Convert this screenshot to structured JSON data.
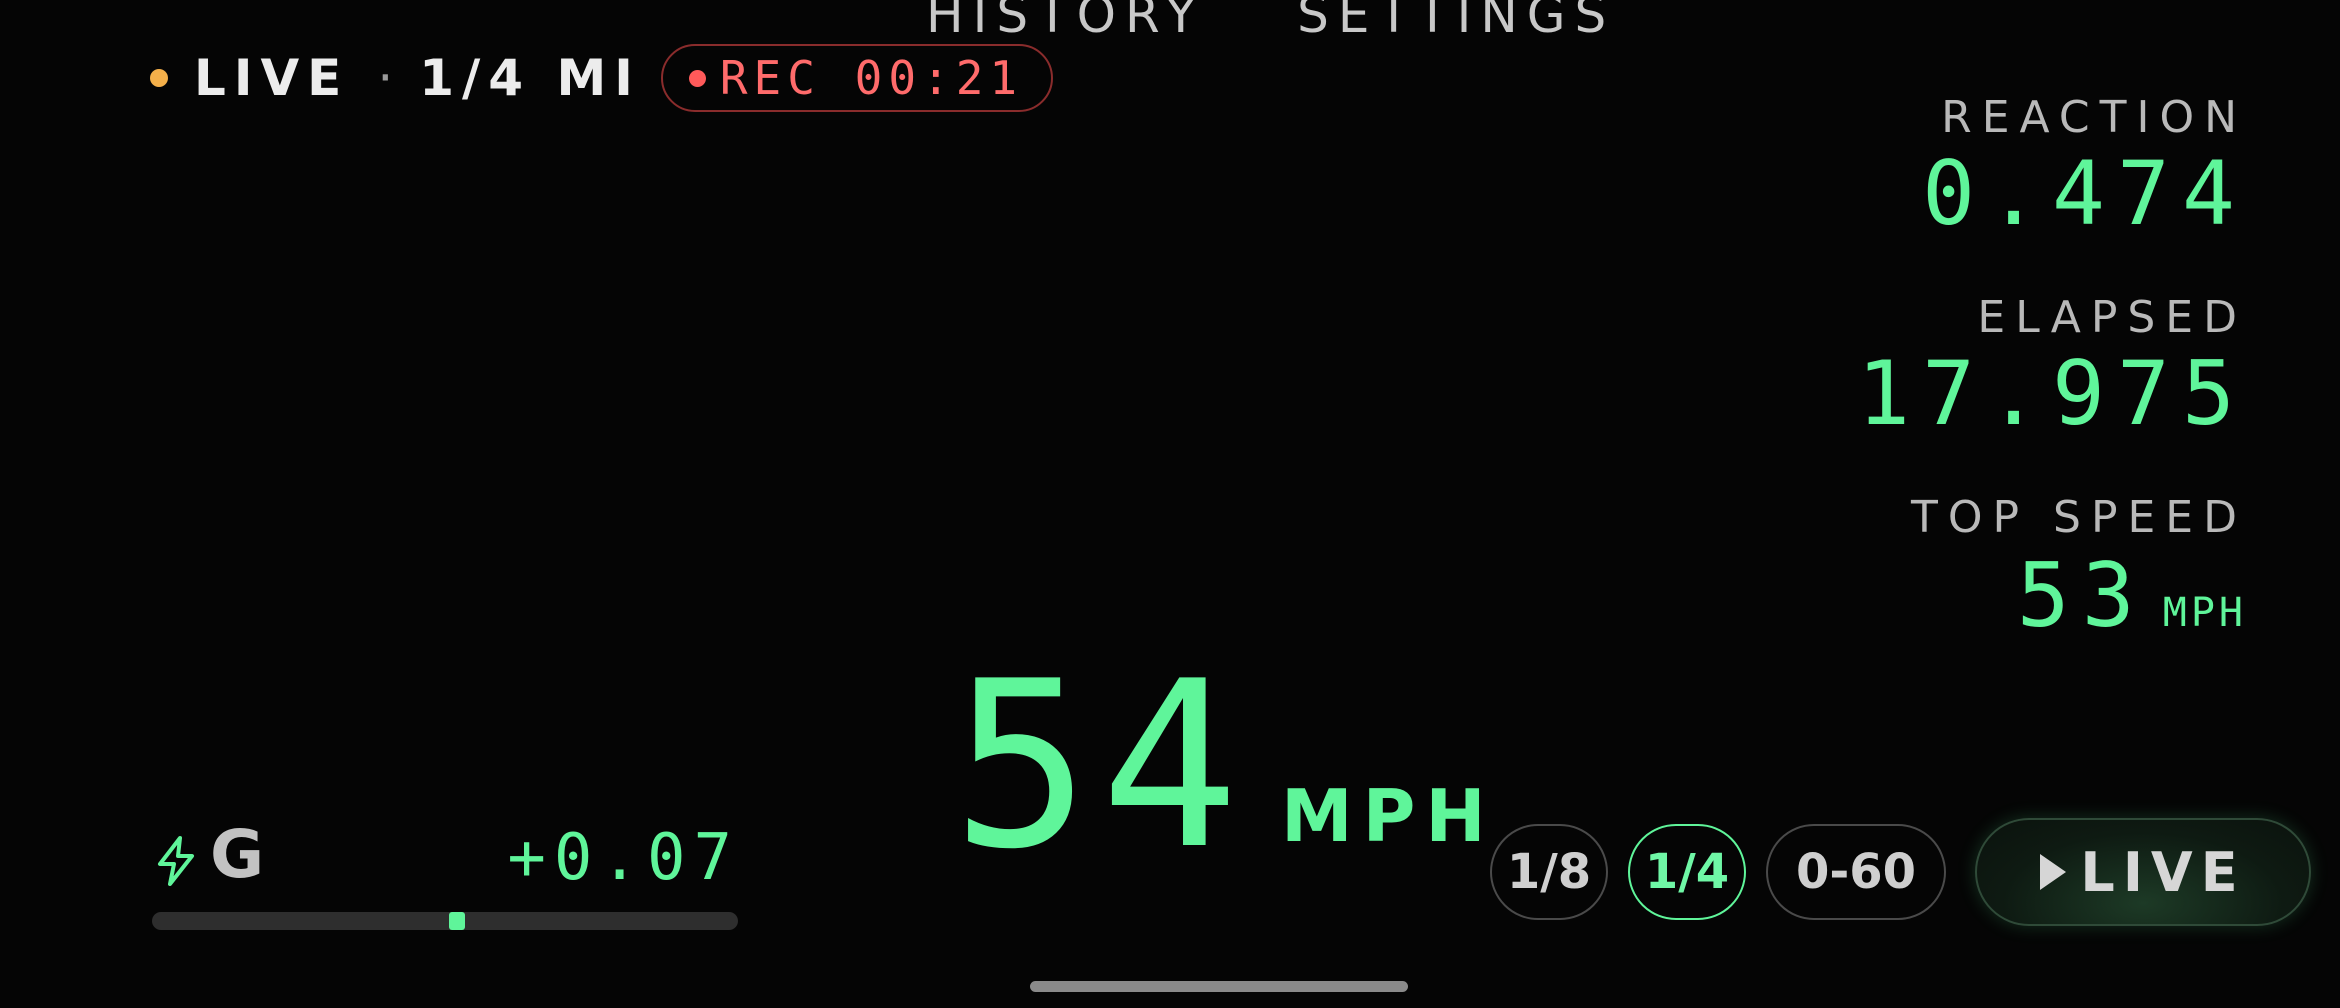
{
  "nav": {
    "history_label": "HISTORY",
    "settings_label": "SETTINGS"
  },
  "status": {
    "mode": "LIVE",
    "separator": "·",
    "distance": "1/4 MI",
    "rec_label": "REC 00:21"
  },
  "stats": {
    "reaction_label": "REACTION",
    "reaction_value": "0.474",
    "elapsed_label": "ELAPSED",
    "elapsed_value": "17.975",
    "top_speed_label": "TOP SPEED",
    "top_speed_value": "53",
    "top_speed_unit": "MPH"
  },
  "speed": {
    "value": "54",
    "unit": "MPH"
  },
  "g_meter": {
    "letter": "G",
    "value": "+0.07",
    "level_fraction": 0.52,
    "icon": "lightning-bolt-icon"
  },
  "modes": {
    "eighth": "1/8",
    "quarter": "1/4",
    "zero_sixty": "0-60",
    "active": "1/4"
  },
  "live_button": {
    "label": "LIVE",
    "icon": "play-icon"
  },
  "colors": {
    "accent_green": "#5ff59a",
    "live_dot": "#f5b04a",
    "rec_red": "#ff6b6b",
    "background": "#050505"
  }
}
